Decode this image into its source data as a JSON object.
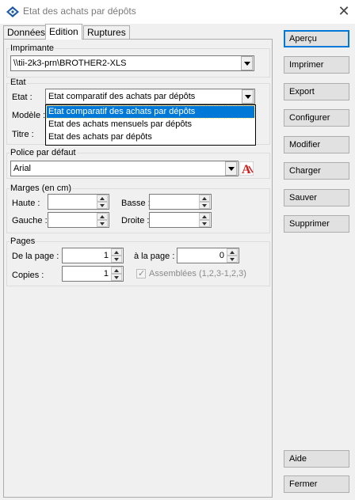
{
  "window": {
    "title": "Etat des achats par dépôts",
    "close_glyph": "✕"
  },
  "tabs": [
    {
      "label": "Données",
      "active": false
    },
    {
      "label": "Edition",
      "active": true
    },
    {
      "label": "Ruptures",
      "active": false
    }
  ],
  "printer_group": {
    "label": "Imprimante",
    "value": "\\\\tii-2k3-prn\\BROTHER2-XLS"
  },
  "etat_group": {
    "label": "Etat",
    "etat_label": "Etat :",
    "etat_value": "Etat comparatif des achats par dépôts",
    "modele_label": "Modèle :",
    "titre_label": "Titre :",
    "options": [
      {
        "label": "Etat comparatif des achats par dépôts",
        "selected": true
      },
      {
        "label": "Etat des achats mensuels par dépôts",
        "selected": false
      },
      {
        "label": "Etat des achats par dépôts",
        "selected": false
      }
    ]
  },
  "font_group": {
    "label": "Police par défaut",
    "value": "Arial",
    "icon": "font-a-icon"
  },
  "margins_group": {
    "label": "Marges (en cm)",
    "haute_label": "Haute :",
    "basse_label": "Basse :",
    "gauche_label": "Gauche :",
    "droite_label": "Droite :",
    "haute_value": "",
    "basse_value": "",
    "gauche_value": "",
    "droite_value": ""
  },
  "pages_group": {
    "label": "Pages",
    "from_label": "De la page :",
    "from_value": "1",
    "to_label": "à la page :",
    "to_value": "0",
    "copies_label": "Copies :",
    "copies_value": "1",
    "collate_label": "Assemblées (1,2,3-1,2,3)",
    "collate_checked": true
  },
  "buttons": {
    "apercu": "Aperçu",
    "imprimer": "Imprimer",
    "export": "Export",
    "configurer": "Configurer",
    "modifier": "Modifier",
    "charger": "Charger",
    "sauver": "Sauver",
    "supprimer": "Supprimer",
    "aide": "Aide",
    "fermer": "Fermer"
  },
  "colors": {
    "selection": "#0078d7",
    "default_button_border": "#0078d7",
    "pdf_red": "#cc2020"
  }
}
